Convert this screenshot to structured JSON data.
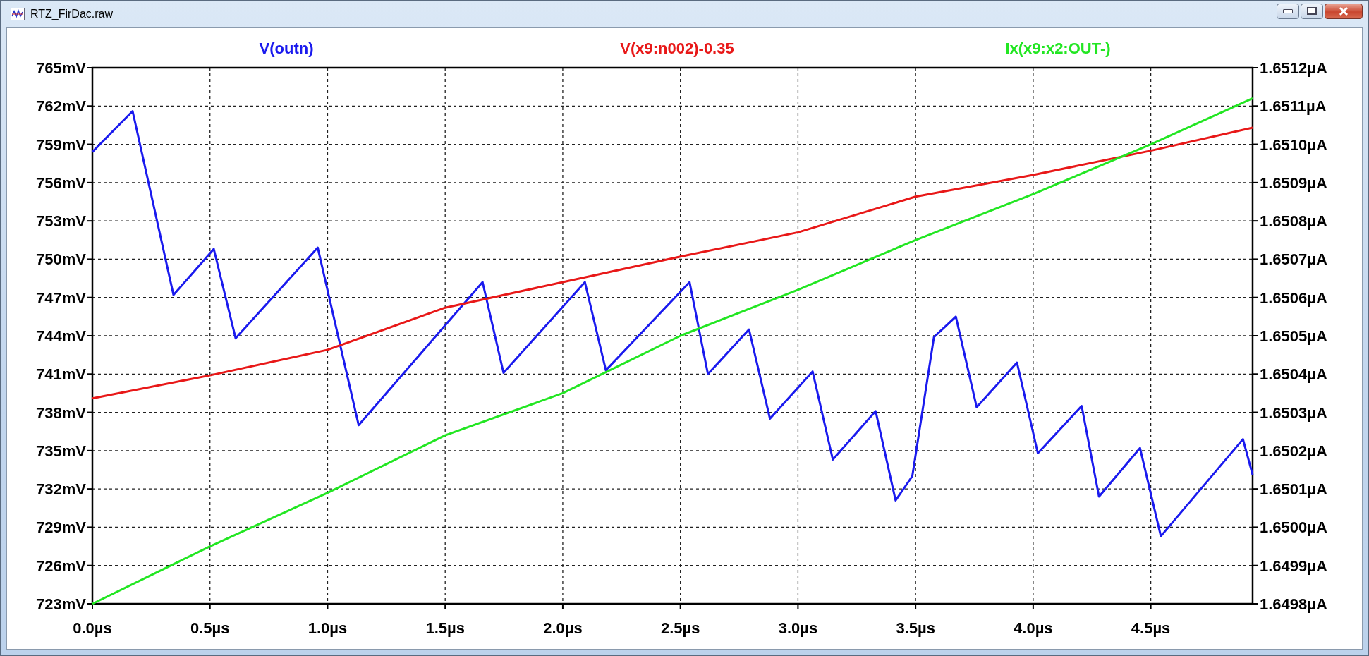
{
  "window": {
    "title": "RTZ_FirDac.raw"
  },
  "plot": {
    "chart_data": {
      "type": "line",
      "grid": true,
      "xlim": [
        0,
        4.933
      ],
      "ylim": [
        723,
        765
      ],
      "y2lim": [
        1.6498,
        1.6512
      ],
      "xticks": [
        {
          "value": 0,
          "label": "0.0µs"
        },
        {
          "value": 0.5,
          "label": "0.5µs"
        },
        {
          "value": 1,
          "label": "1.0µs"
        },
        {
          "value": 1.5,
          "label": "1.5µs"
        },
        {
          "value": 2,
          "label": "2.0µs"
        },
        {
          "value": 2.5,
          "label": "2.5µs"
        },
        {
          "value": 3,
          "label": "3.0µs"
        },
        {
          "value": 3.5,
          "label": "3.5µs"
        },
        {
          "value": 4,
          "label": "4.0µs"
        },
        {
          "value": 4.5,
          "label": "4.5µs"
        }
      ],
      "yticks": [
        {
          "value": 723,
          "label": "723mV"
        },
        {
          "value": 726,
          "label": "726mV"
        },
        {
          "value": 729,
          "label": "729mV"
        },
        {
          "value": 732,
          "label": "732mV"
        },
        {
          "value": 735,
          "label": "735mV"
        },
        {
          "value": 738,
          "label": "738mV"
        },
        {
          "value": 741,
          "label": "741mV"
        },
        {
          "value": 744,
          "label": "744mV"
        },
        {
          "value": 747,
          "label": "747mV"
        },
        {
          "value": 750,
          "label": "750mV"
        },
        {
          "value": 753,
          "label": "753mV"
        },
        {
          "value": 756,
          "label": "756mV"
        },
        {
          "value": 759,
          "label": "759mV"
        },
        {
          "value": 762,
          "label": "762mV"
        },
        {
          "value": 765,
          "label": "765mV"
        }
      ],
      "y2ticks": [
        {
          "value": 1.6498,
          "label": "1.6498µA"
        },
        {
          "value": 1.6499,
          "label": "1.6499µA"
        },
        {
          "value": 1.65,
          "label": "1.6500µA"
        },
        {
          "value": 1.6501,
          "label": "1.6501µA"
        },
        {
          "value": 1.6502,
          "label": "1.6502µA"
        },
        {
          "value": 1.6503,
          "label": "1.6503µA"
        },
        {
          "value": 1.6504,
          "label": "1.6504µA"
        },
        {
          "value": 1.6505,
          "label": "1.6505µA"
        },
        {
          "value": 1.6506,
          "label": "1.6506µA"
        },
        {
          "value": 1.6507,
          "label": "1.6507µA"
        },
        {
          "value": 1.6508,
          "label": "1.6508µA"
        },
        {
          "value": 1.6509,
          "label": "1.6509µA"
        },
        {
          "value": 1.651,
          "label": "1.6510µA"
        },
        {
          "value": 1.6511,
          "label": "1.6511µA"
        },
        {
          "value": 1.6512,
          "label": "1.6512µA"
        }
      ],
      "series": [
        {
          "name": "V(outn)",
          "color": "#1a1aee",
          "x": [
            0,
            0.171,
            0.345,
            0.516,
            0.609,
            0.958,
            1.132,
            1.659,
            1.748,
            2.094,
            2.183,
            2.539,
            2.617,
            2.792,
            2.881,
            3.062,
            3.148,
            3.33,
            3.415,
            3.486,
            3.578,
            3.671,
            3.76,
            3.931,
            4.02,
            4.206,
            4.28,
            4.454,
            4.543,
            4.892,
            4.933
          ],
          "values": [
            758.4,
            761.6,
            747.2,
            750.8,
            743.8,
            750.9,
            737.0,
            748.2,
            741.1,
            748.2,
            741.3,
            748.2,
            741.0,
            744.5,
            737.5,
            741.2,
            734.3,
            738.1,
            731.1,
            733.0,
            743.9,
            745.5,
            738.4,
            741.9,
            734.8,
            738.5,
            731.4,
            735.2,
            728.3,
            735.9,
            733.1
          ]
        },
        {
          "name": "V(x9:n002)-0.35",
          "color": "#e81818",
          "x": [
            0,
            0.5,
            1,
            1.5,
            2,
            2.5,
            3,
            3.5,
            4,
            4.5,
            4.933
          ],
          "values": [
            739.1,
            740.9,
            742.9,
            746.2,
            748.2,
            750.2,
            752.1,
            754.9,
            756.6,
            758.5,
            760.3
          ]
        },
        {
          "name": "Ix(x9:x2:OUT-)",
          "color": "#22e622",
          "axis": "y2",
          "x": [
            0,
            0.5,
            1,
            1.5,
            2,
            2.5,
            3,
            3.5,
            4,
            4.5,
            4.933
          ],
          "values": [
            1.6498,
            1.64995,
            1.65009,
            1.65024,
            1.65035,
            1.6505,
            1.65062,
            1.65075,
            1.65087,
            1.651,
            1.65112
          ]
        }
      ]
    }
  }
}
